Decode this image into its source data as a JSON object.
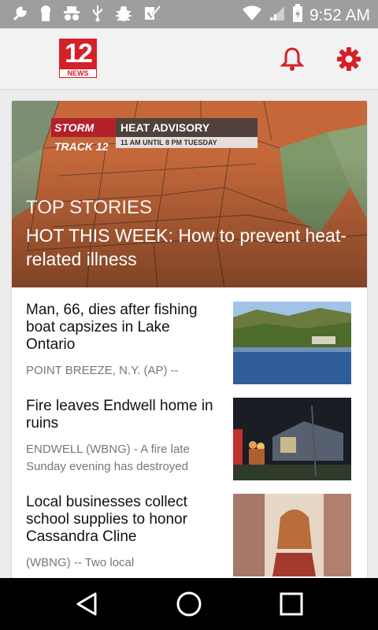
{
  "status_bar": {
    "time": "9:52 AM",
    "left_icons": [
      "wrench-icon",
      "keyhole-icon",
      "incognito-icon",
      "usb-icon",
      "bug-icon",
      "checkbox-icon"
    ],
    "right_icons": [
      "wifi-icon",
      "signal-icon",
      "battery-icon"
    ]
  },
  "app_bar": {
    "logo_number": "12",
    "logo_word": "NEWS",
    "icons": [
      "bell-icon",
      "gear-icon"
    ],
    "accent_color": "#d32029"
  },
  "hero": {
    "advisory_tag": "STORM TRACK 12",
    "advisory_title": "HEAT ADVISORY",
    "advisory_time": "11 AM UNTIL 8 PM TUESDAY",
    "section_label": "TOP STORIES",
    "headline": "HOT THIS WEEK: How to prevent heat-related illness"
  },
  "stories": [
    {
      "title": "Man, 66, dies after fishing boat capsizes in Lake Ontario",
      "summary": "POINT BREEZE, N.Y. (AP) --"
    },
    {
      "title": "Fire leaves Endwell home in ruins",
      "summary": "ENDWELL (WBNG) - A fire late Sunday evening has destroyed"
    },
    {
      "title": "Local businesses collect school supplies to honor Cassandra Cline",
      "summary": "(WBNG) -- Two local"
    }
  ],
  "nav_bar": {
    "icons": [
      "back-icon",
      "home-icon",
      "recents-icon"
    ]
  }
}
